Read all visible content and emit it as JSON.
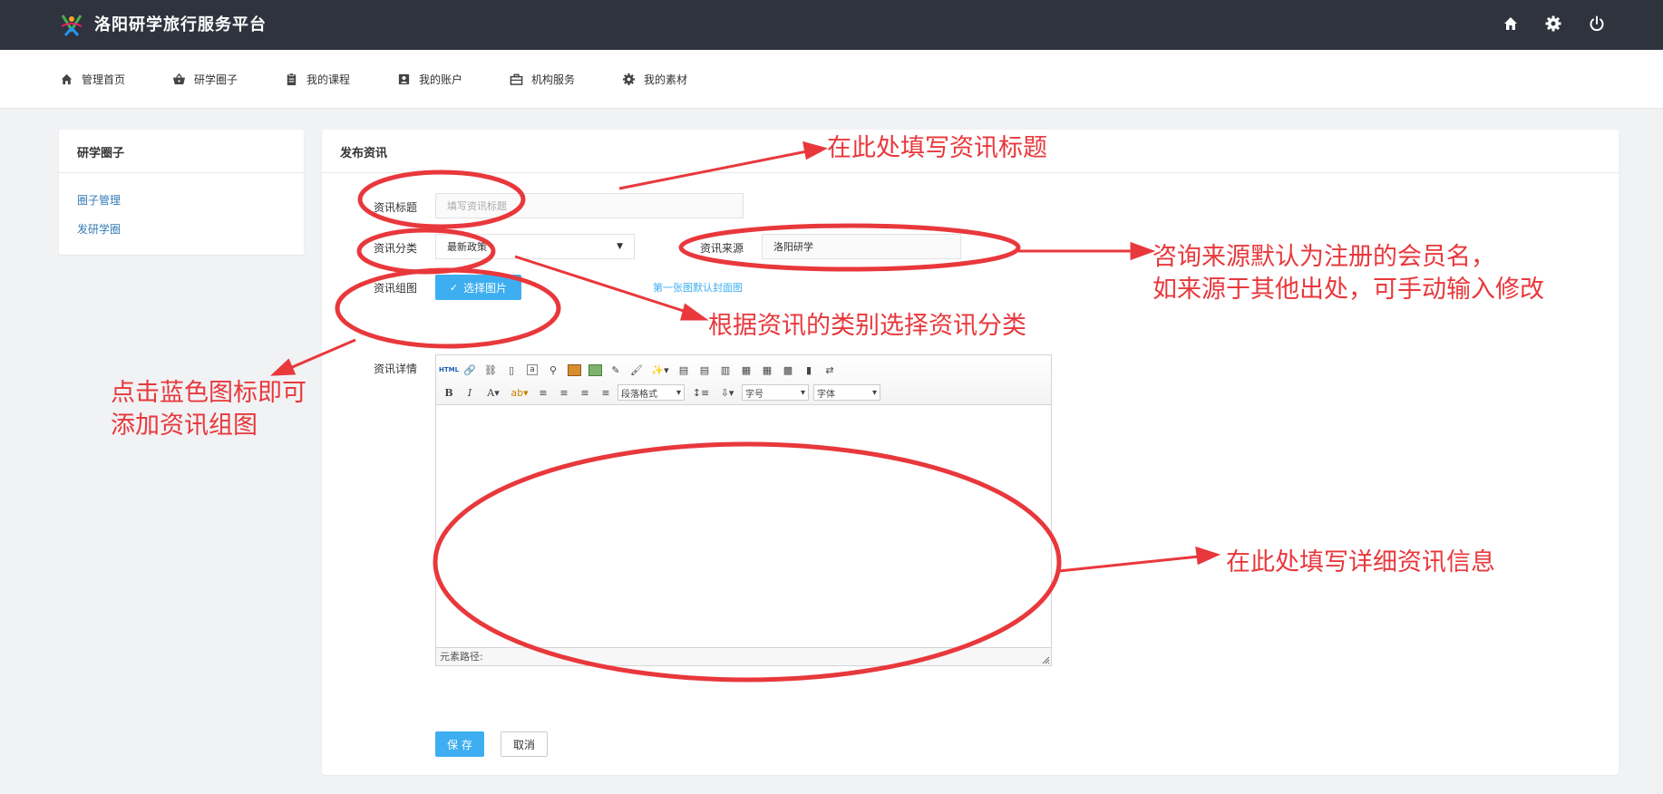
{
  "header": {
    "site_title": "洛阳研学旅行服务平台",
    "icons": [
      "home-icon",
      "gear-icon",
      "power-icon"
    ],
    "bg_color": "#2f333e"
  },
  "nav": {
    "items": [
      {
        "label": "管理首页",
        "icon": "home-icon"
      },
      {
        "label": "研学圈子",
        "icon": "basket-icon"
      },
      {
        "label": "我的课程",
        "icon": "clipboard-icon"
      },
      {
        "label": "我的账户",
        "icon": "account-icon"
      },
      {
        "label": "机构服务",
        "icon": "briefcase-icon"
      },
      {
        "label": "我的素材",
        "icon": "gear-icon"
      }
    ]
  },
  "sidebar": {
    "title": "研学圈子",
    "links": [
      {
        "label": "圈子管理"
      },
      {
        "label": "发研学圈"
      }
    ]
  },
  "form": {
    "panel_title": "发布资讯",
    "title_label": "资讯标题",
    "title_placeholder": "填写资讯标题",
    "category_label": "资讯分类",
    "category_value": "最新政策",
    "source_label": "资讯来源",
    "source_value": "洛阳研学",
    "images_label": "资讯组图",
    "upload_button": "选择图片",
    "cover_hint": "第一张图默认封面图",
    "detail_label": "资讯详情",
    "save_button": "保 存",
    "cancel_button": "取消"
  },
  "editor": {
    "html_button": "HTML",
    "paragraph_combo": "段落格式",
    "font_size_combo": "字号",
    "font_family_combo": "字体",
    "status_text": "元素路径:"
  },
  "annotations": {
    "color": "#e8383c",
    "title_note": "在此处填写资讯标题",
    "source_note_line1": "咨询来源默认为注册的会员名，",
    "source_note_line2": "如来源于其他出处，可手动输入修改",
    "category_note": "根据资讯的类别选择资讯分类",
    "image_note_line1": "点击蓝色图标即可",
    "image_note_line2": "添加资讯组图",
    "detail_note": "在此处填写详细资讯信息"
  },
  "accent_color": "#3daef0"
}
